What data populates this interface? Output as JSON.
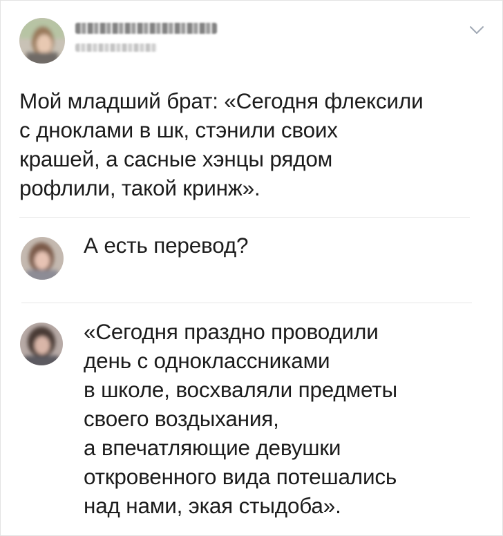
{
  "post": {
    "author": {
      "avatar_icon": "avatar-photo-blurred",
      "name_blurred": true,
      "meta_blurred": true
    },
    "menu_icon": "chevron-down-icon",
    "text": "Мой младший брат: «Сегодня флексили\nс дноклами в шк, стэнили своих\nкрашей, а сасные хэнцы рядом\nрофлили, такой кринж»."
  },
  "comments": [
    {
      "avatar_icon": "avatar-photo-blurred",
      "text": "А есть перевод?"
    },
    {
      "avatar_icon": "avatar-photo-blurred",
      "text": "«Сегодня праздно проводили\nдень с одноклассниками\nв школе, восхваляли предметы\nсвоего воздыхания,\nа впечатляющие девушки\nоткровенного вида потешались\nнад нами, экая стыдоба»."
    }
  ],
  "colors": {
    "text": "#1c1c1c",
    "divider": "#e6e6e6",
    "chevron": "#a0a8b4"
  }
}
